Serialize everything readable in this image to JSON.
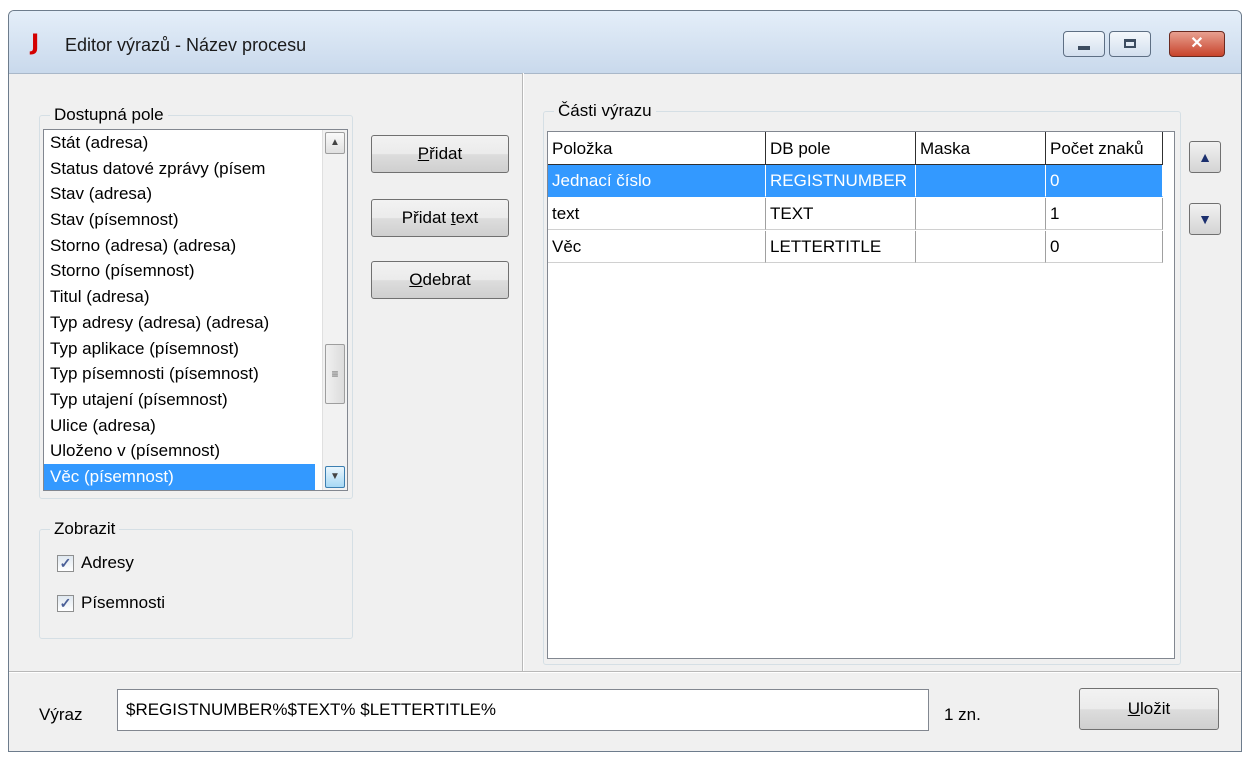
{
  "window": {
    "title": "Editor výrazů - Název procesu",
    "icon": "J"
  },
  "available_fields": {
    "legend": "Dostupná pole",
    "items": [
      "Stát (adresa)",
      "Status datové zprávy (písem",
      "Stav (adresa)",
      "Stav (písemnost)",
      "Storno (adresa) (adresa)",
      "Storno (písemnost)",
      "Titul (adresa)",
      "Typ adresy (adresa) (adresa)",
      "Typ aplikace (písemnost)",
      "Typ písemnosti (písemnost)",
      "Typ utajení (písemnost)",
      "Ulice (adresa)",
      "Uloženo v (písemnost)",
      "Věc (písemnost)"
    ],
    "selected_index": 13
  },
  "buttons": {
    "add": {
      "underline": "P",
      "rest": "řidat"
    },
    "add_text": {
      "before": "Přidat ",
      "underline": "t",
      "after": "ext"
    },
    "remove": {
      "underline": "O",
      "rest": "debrat"
    },
    "save": {
      "underline": "U",
      "rest": "ložit"
    }
  },
  "show": {
    "legend": "Zobrazit",
    "addresses": {
      "label": "Adresy",
      "checked": true
    },
    "documents": {
      "label": "Písemnosti",
      "checked": true
    }
  },
  "expression_parts": {
    "legend": "Části výrazu",
    "columns": [
      "Položka",
      "DB pole",
      "Maska",
      "Počet znaků"
    ],
    "rows": [
      [
        "Jednací číslo",
        "REGISTNUMBER",
        "",
        "0"
      ],
      [
        "text",
        "TEXT",
        "",
        "1"
      ],
      [
        "Věc",
        "LETTERTITLE",
        "",
        "0"
      ]
    ],
    "selected_row": 0
  },
  "expression": {
    "label": "Výraz",
    "value": "$REGISTNUMBER%$TEXT% $LETTERTITLE%",
    "count": "1 zn."
  },
  "icons": {
    "up": "arrow-up-icon",
    "down": "arrow-down-icon",
    "close": "close-icon"
  }
}
